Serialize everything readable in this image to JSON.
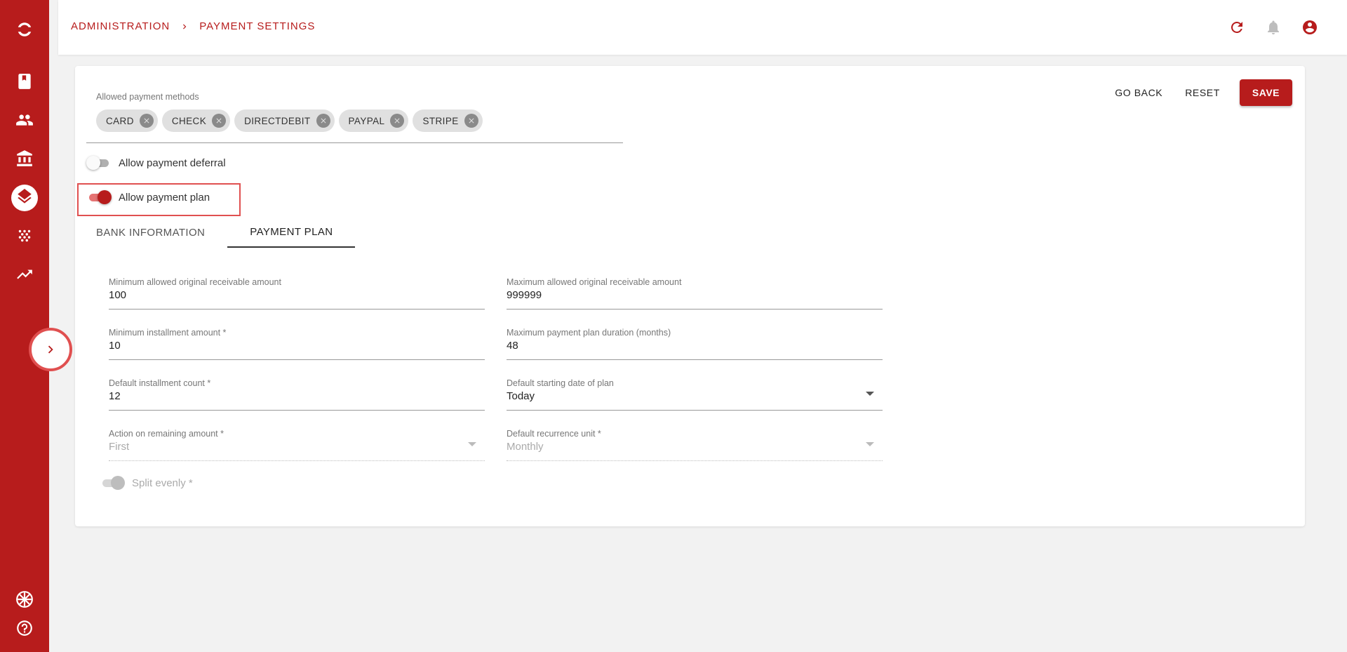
{
  "breadcrumb": {
    "items": [
      "ADMINISTRATION",
      "PAYMENT SETTINGS"
    ]
  },
  "sidebar": {
    "items": [
      {
        "icon": "book-icon"
      },
      {
        "icon": "people-icon"
      },
      {
        "icon": "bank-icon"
      },
      {
        "icon": "layers-icon",
        "active": true
      },
      {
        "icon": "dots-icon"
      },
      {
        "icon": "trending-up-icon"
      }
    ],
    "bottom": [
      {
        "icon": "uk-flag-icon"
      },
      {
        "icon": "help-icon"
      }
    ]
  },
  "header_icons": [
    "refresh-icon",
    "bell-icon",
    "account-icon"
  ],
  "actions": {
    "go_back": "GO BACK",
    "reset": "RESET",
    "save": "SAVE"
  },
  "payment_methods": {
    "label": "Allowed payment methods",
    "chips": [
      "CARD",
      "CHECK",
      "DIRECTDEBIT",
      "PAYPAL",
      "STRIPE"
    ]
  },
  "switches": {
    "deferral": {
      "label": "Allow payment deferral",
      "on": false
    },
    "plan": {
      "label": "Allow payment plan",
      "on": true
    }
  },
  "tabs": [
    {
      "label": "BANK INFORMATION",
      "active": false
    },
    {
      "label": "PAYMENT PLAN",
      "active": true
    }
  ],
  "fields": {
    "min_receivable": {
      "label": "Minimum allowed original receivable amount",
      "value": "100"
    },
    "max_receivable": {
      "label": "Maximum allowed original receivable amount",
      "value": "999999"
    },
    "min_installment": {
      "label": "Minimum installment amount *",
      "value": "10"
    },
    "max_duration": {
      "label": "Maximum payment plan duration (months)",
      "value": "48"
    },
    "default_count": {
      "label": "Default installment count *",
      "value": "12"
    },
    "default_start": {
      "label": "Default starting date of plan",
      "value": "Today"
    },
    "remaining_action": {
      "label": "Action on remaining amount *",
      "value": "First"
    },
    "recurrence_unit": {
      "label": "Default recurrence unit *",
      "value": "Monthly"
    }
  },
  "split_evenly": {
    "label": "Split evenly *"
  },
  "colors": {
    "brand": "#b71c1c",
    "highlight": "#e05050"
  }
}
